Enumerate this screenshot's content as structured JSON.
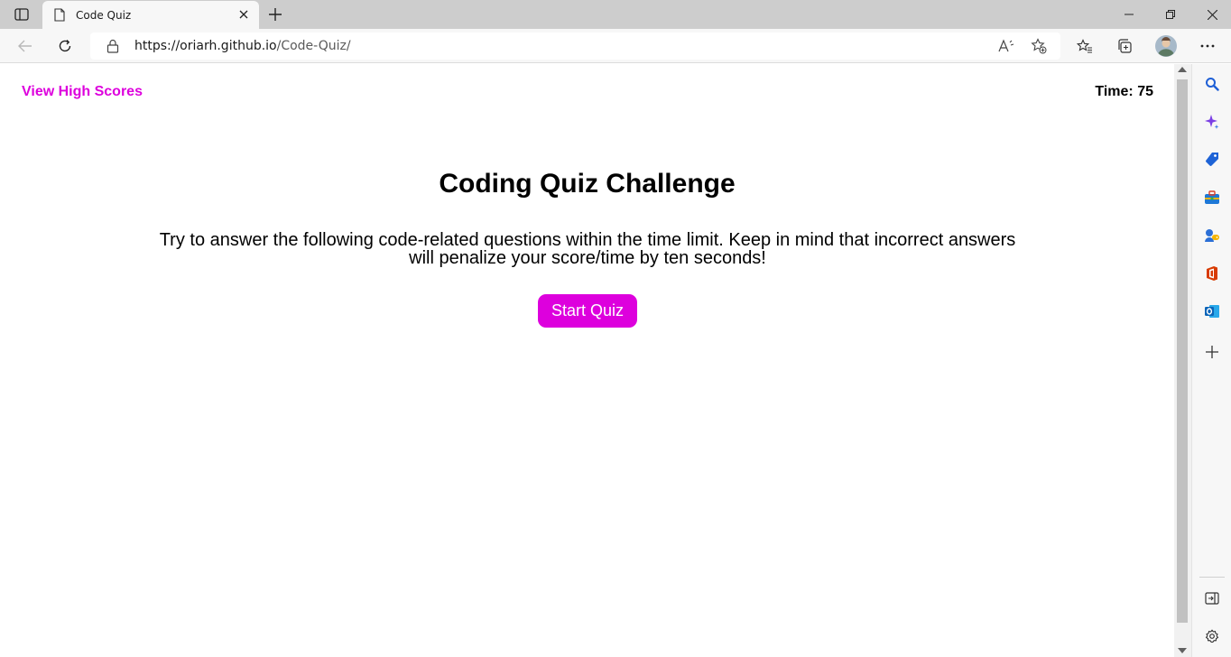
{
  "browser": {
    "tab": {
      "title": "Code Quiz"
    },
    "address": {
      "host": "https://oriarh.github.io",
      "path": "/Code-Quiz/"
    }
  },
  "page": {
    "high_scores_link": "View High Scores",
    "timer": "Time: 75",
    "heading": "Coding Quiz Challenge",
    "intro_line1": "Try to answer the following code-related questions within the time limit. Keep in mind that incorrect answers",
    "intro_line2": "will penalize your score/time by ten seconds!",
    "start_button": "Start Quiz"
  },
  "colors": {
    "accent": "#dd00dd",
    "chrome": "#cdcdcd",
    "toolbar": "#f7f7f7"
  },
  "icons": {
    "tab_actions": "tab-actions-icon",
    "favicon": "page-icon",
    "close_tab": "close-icon",
    "new_tab": "plus-icon",
    "back": "arrow-left-icon",
    "refresh": "refresh-icon",
    "lock": "lock-icon",
    "read_aloud": "read-aloud-icon",
    "add_favorite": "star-add-icon",
    "favorites": "favorites-icon",
    "collections": "collections-icon",
    "profile": "avatar",
    "more": "more-icon",
    "sidebar": [
      "search-icon",
      "copilot-icon",
      "shopping-tag-icon",
      "tools-icon",
      "games-icon",
      "office-icon",
      "outlook-icon",
      "add-icon"
    ],
    "hide_sidebar": "hide-sidebar-icon",
    "settings": "gear-icon"
  }
}
